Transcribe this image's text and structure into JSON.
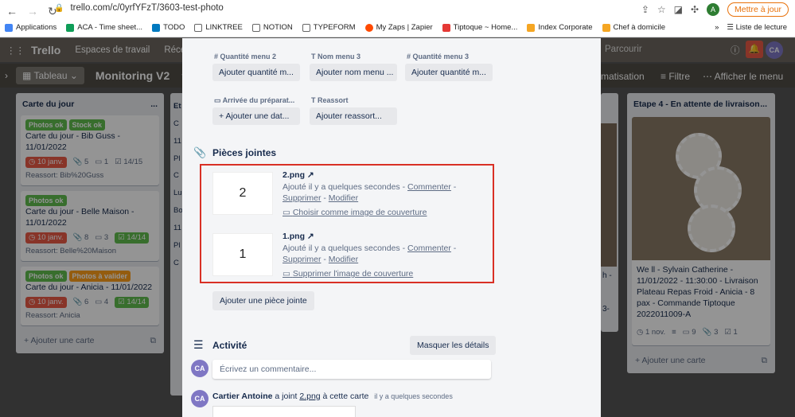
{
  "browser": {
    "url": "trello.com/c/0yrfYFzT/3603-test-photo",
    "update_button": "Mettre à jour",
    "avatar_letter": "A",
    "bookmarks": [
      "Applications",
      "ACA - Time sheet...",
      "TODO",
      "LINKTREE",
      "NOTION",
      "TYPEFORM",
      "My Zaps | Zapier",
      "Tiptoque ~ Home...",
      "Index Corporate",
      "Chef à domicile"
    ],
    "reading_list": "Liste de lecture",
    "more": "»"
  },
  "trello": {
    "logo": "Trello",
    "workspaces": "Espaces de travail",
    "recent": "Réce",
    "search_placeholder": "Parcourir",
    "user_initials": "CA"
  },
  "board": {
    "view": "Tableau",
    "title": "Monitoring V2",
    "automation": "matisation",
    "filter": "Filtre",
    "show_menu": "Afficher le menu"
  },
  "list1": {
    "title": "Carte du jour",
    "menu": "...",
    "cards": [
      {
        "labels": [
          {
            "text": "Photos ok",
            "color": "#61bd4f"
          },
          {
            "text": "Stock ok",
            "color": "#61bd4f"
          }
        ],
        "title": "Carte du jour - Bib Guss - 11/01/2022",
        "due": "10 janv.",
        "b1": "5",
        "b2": "1",
        "b3": "14/15",
        "note": "Reassort: Bib%20Guss"
      },
      {
        "labels": [
          {
            "text": "Photos ok",
            "color": "#61bd4f"
          }
        ],
        "title": "Carte du jour - Belle Maison - 11/01/2022",
        "due": "10 janv.",
        "b1": "8",
        "b2": "3",
        "b3": "14/14",
        "note": "Reassort: Belle%20Maison"
      },
      {
        "labels": [
          {
            "text": "Photos ok",
            "color": "#61bd4f"
          },
          {
            "text": "Photos à valider",
            "color": "#ff9f1a"
          }
        ],
        "title": "Carte du jour - Anicia - 11/01/2022",
        "due": "10 janv.",
        "b1": "6",
        "b2": "4",
        "b3": "14/14",
        "note": "Reassort: Anicia"
      }
    ],
    "add": "Ajouter une carte"
  },
  "list2_peek": [
    "Et",
    "C",
    "11",
    "Pl",
    "C",
    "Lu",
    "Bo",
    "11",
    "Pl",
    "C"
  ],
  "list_right": {
    "title": "Etape 4 - En attente de livraison",
    "card_text": "We ll - Sylvain Catherine - 11/01/2022 - 11:30:00 - Livraison Plateau Repas Froid - Anicia - 8 pax - Commande Tiptoque 2022011009-A",
    "due": "1 nov.",
    "b1": "9",
    "b2": "3",
    "b3": "1",
    "add": "Ajouter une carte",
    "peek": [
      "h -",
      "3-"
    ]
  },
  "modal": {
    "fields": [
      {
        "label": "Quantité menu 2",
        "button": "Ajouter quantité m..."
      },
      {
        "label": "Nom menu 3",
        "button": "Ajouter nom menu ..."
      },
      {
        "label": "Quantité menu 3",
        "button": "Ajouter quantité m..."
      },
      {
        "label": "Arrivée du préparat...",
        "button": "+ Ajouter une dat..."
      },
      {
        "label": "Reassort",
        "button": "Ajouter reassort..."
      }
    ],
    "attachments_title": "Pièces jointes",
    "attachments": [
      {
        "thumb": "2",
        "name": "2.png",
        "added": "Ajouté il y a quelques secondes",
        "comment": "Commenter",
        "delete": "Supprimer",
        "edit": "Modifier",
        "cover": "Choisir comme image de couverture"
      },
      {
        "thumb": "1",
        "name": "1.png",
        "added": "Ajouté il y a quelques secondes",
        "comment": "Commenter",
        "delete": "Supprimer",
        "edit": "Modifier",
        "cover": "Supprimer l'image de couverture"
      }
    ],
    "add_attachment": "Ajouter une pièce jointe",
    "activity_title": "Activité",
    "hide_details": "Masquer les détails",
    "comment_placeholder": "Écrivez un commentaire...",
    "activity": {
      "user": "Cartier Antoine",
      "action": "a joint",
      "file": "2.png",
      "rest": "à cette carte",
      "time": "il y a quelques secondes"
    },
    "initials": "CA"
  }
}
